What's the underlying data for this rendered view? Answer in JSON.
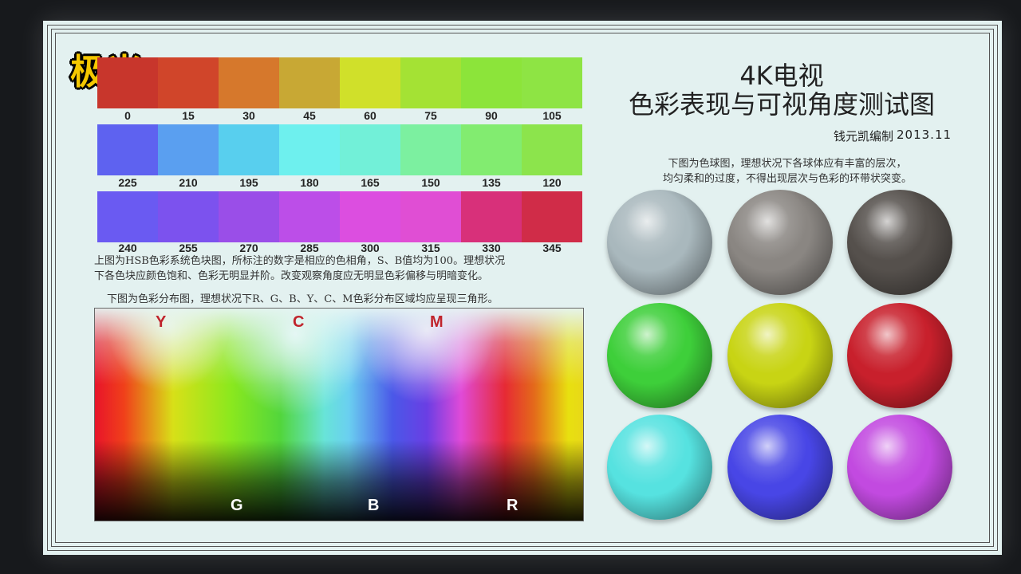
{
  "logo": "极米",
  "title": {
    "line1": "4K电视",
    "line2": "色彩表现与可视角度测试图"
  },
  "author": "钱元凯编制",
  "date": "2013.11",
  "sphere_desc": [
    "下图为色球图，理想状况下各球体应有丰富的层次，",
    "均匀柔和的过度，不得出现层次与色彩的环带状突变。"
  ],
  "hue_desc": [
    "上图为HSB色彩系统色块图，所标注的数字是相应的色相角，S、B值均为100。理想状况",
    "下各色块应颜色饱和、色彩无明显并阶。改变观察角度应无明显色彩偏移与明暗变化。"
  ],
  "gamut_desc": "下图为色彩分布图，理想状况下R、G、B、Y、C、M色彩分布区域均应呈现三角形。",
  "hue_rows": [
    {
      "labels": [
        "0",
        "15",
        "30",
        "45",
        "60",
        "75",
        "90",
        "105"
      ],
      "colors": [
        "#c8362c",
        "#d0452a",
        "#d6782c",
        "#c8a834",
        "#d0e02a",
        "#a4e234",
        "#8ce43a",
        "#8ee444"
      ]
    },
    {
      "labels": [
        "225",
        "210",
        "195",
        "180",
        "165",
        "150",
        "135",
        "120"
      ],
      "colors": [
        "#5e62f0",
        "#5a9ff0",
        "#58cfee",
        "#6ef0ee",
        "#72f0d8",
        "#7cf0a0",
        "#82ec70",
        "#8ce44c"
      ]
    },
    {
      "labels": [
        "240",
        "255",
        "270",
        "285",
        "300",
        "315",
        "330",
        "345"
      ],
      "colors": [
        "#6a5af2",
        "#7c52ee",
        "#9a4ee8",
        "#bc4ee8",
        "#dc4ee0",
        "#e04ed4",
        "#d8307a",
        "#d02c48"
      ]
    }
  ],
  "gamut_letters": {
    "top": [
      {
        "t": "Y",
        "c": "#c0242c"
      },
      {
        "t": "C",
        "c": "#c0242c"
      },
      {
        "t": "M",
        "c": "#c0242c"
      }
    ],
    "bottom": [
      {
        "t": "G",
        "c": "#ffffff"
      },
      {
        "t": "B",
        "c": "#ffffff"
      },
      {
        "t": "R",
        "c": "#ffffff"
      }
    ]
  },
  "spheres": [
    "#a9b8bd",
    "#8a8682",
    "#55504c",
    "#3ecf3a",
    "#c8d414",
    "#c8202c",
    "#56e2e0",
    "#4846e6",
    "#c24ae0"
  ]
}
